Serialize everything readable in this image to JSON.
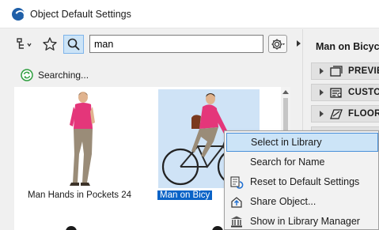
{
  "window": {
    "title": "Object Default Settings"
  },
  "toolbar": {
    "search_value": "man",
    "search_placeholder": ""
  },
  "status": {
    "text": "Searching..."
  },
  "results": {
    "items": [
      {
        "label": "Man Hands in Pockets 24",
        "selected": false
      },
      {
        "label": "Man on Bicy",
        "selected": true
      }
    ]
  },
  "details": {
    "object_name": "Man on Bicycle",
    "panels": [
      {
        "label": "PREVIE",
        "icon": "preview-icon"
      },
      {
        "label": "CUSTO",
        "icon": "custom-settings-icon"
      },
      {
        "label": "FLOOR",
        "icon": "floor-plan-icon"
      }
    ]
  },
  "context_menu": {
    "items": [
      {
        "label": "Select in Library",
        "icon": "",
        "active": true
      },
      {
        "label": "Search for Name",
        "icon": "",
        "active": false
      },
      {
        "label": "Reset to Default Settings",
        "icon": "reset-settings-icon",
        "active": false
      },
      {
        "label": "Share Object...",
        "icon": "share-object-icon",
        "active": false
      },
      {
        "label": "Show in Library Manager",
        "icon": "library-manager-icon",
        "active": false
      }
    ]
  },
  "colors": {
    "selection": "#0a63c7",
    "hover": "#cce4f7",
    "active_tool": "#cce4f7",
    "status_icon": "#2e9e3f",
    "app_icon": "#1f5fa8"
  }
}
